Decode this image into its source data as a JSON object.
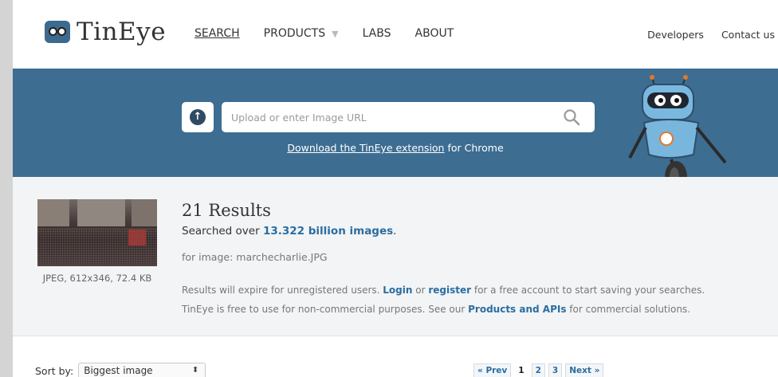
{
  "header": {
    "logo_text": "TinEye",
    "nav": [
      {
        "label": "SEARCH",
        "active": true
      },
      {
        "label": "PRODUCTS",
        "has_dropdown": true
      },
      {
        "label": "LABS"
      },
      {
        "label": "ABOUT"
      }
    ],
    "top_links": [
      "Developers",
      "Contact us"
    ]
  },
  "search": {
    "placeholder": "Upload or enter Image URL",
    "extension_link": "Download the TinEye extension",
    "extension_suffix": " for Chrome"
  },
  "result": {
    "title": "21 Results",
    "searched_prefix": "Searched over ",
    "searched_count": "13.322 billion images",
    "searched_suffix": ".",
    "for_image": "for image: marchecharlie.JPG",
    "thumb_meta": "JPEG, 612x346, 72.4 KB",
    "line1": {
      "a": "Results will expire for unregistered users. ",
      "login": "Login",
      "b": " or ",
      "register": "register",
      "c": " for a free account to start saving your searches."
    },
    "line2": {
      "a": "TinEye is free to use for non-commercial purposes. See our ",
      "products": "Products and APIs",
      "b": " for commercial solutions."
    }
  },
  "sort": {
    "label": "Sort by:",
    "selected": "Biggest image"
  },
  "pagination": {
    "prev": "« Prev",
    "pages": [
      "1",
      "2",
      "3"
    ],
    "current": "1",
    "next": "Next »"
  },
  "colors": {
    "band": "#3e6d92",
    "link": "#2b6da1"
  }
}
